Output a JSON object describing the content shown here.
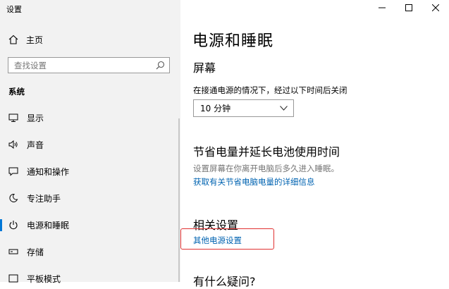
{
  "window": {
    "title": "设置"
  },
  "sidebar": {
    "home_label": "主页",
    "search_placeholder": "查找设置",
    "section": "系统",
    "items": [
      {
        "label": "显示",
        "icon": "monitor-icon"
      },
      {
        "label": "声音",
        "icon": "speaker-icon"
      },
      {
        "label": "通知和操作",
        "icon": "notification-icon"
      },
      {
        "label": "专注助手",
        "icon": "moon-icon"
      },
      {
        "label": "电源和睡眠",
        "icon": "power-icon",
        "active": true
      },
      {
        "label": "存储",
        "icon": "storage-icon"
      },
      {
        "label": "平板模式",
        "icon": "tablet-icon"
      }
    ]
  },
  "main": {
    "title": "电源和睡眠",
    "screen": {
      "heading": "屏幕",
      "label": "在接通电源的情况下，经过以下时间后关闭",
      "value": "10 分钟"
    },
    "battery": {
      "heading": "节省电量并延长电池使用时间",
      "description": "设置屏幕在你离开电脑后多久进入睡眠。",
      "link": "获取有关节省电脑电量的详细信息"
    },
    "related": {
      "heading": "相关设置",
      "link": "其他电源设置"
    },
    "question": {
      "heading": "有什么疑问?"
    }
  },
  "colors": {
    "accent": "#0078d7",
    "link": "#0063b1",
    "highlight": "#e03131"
  }
}
